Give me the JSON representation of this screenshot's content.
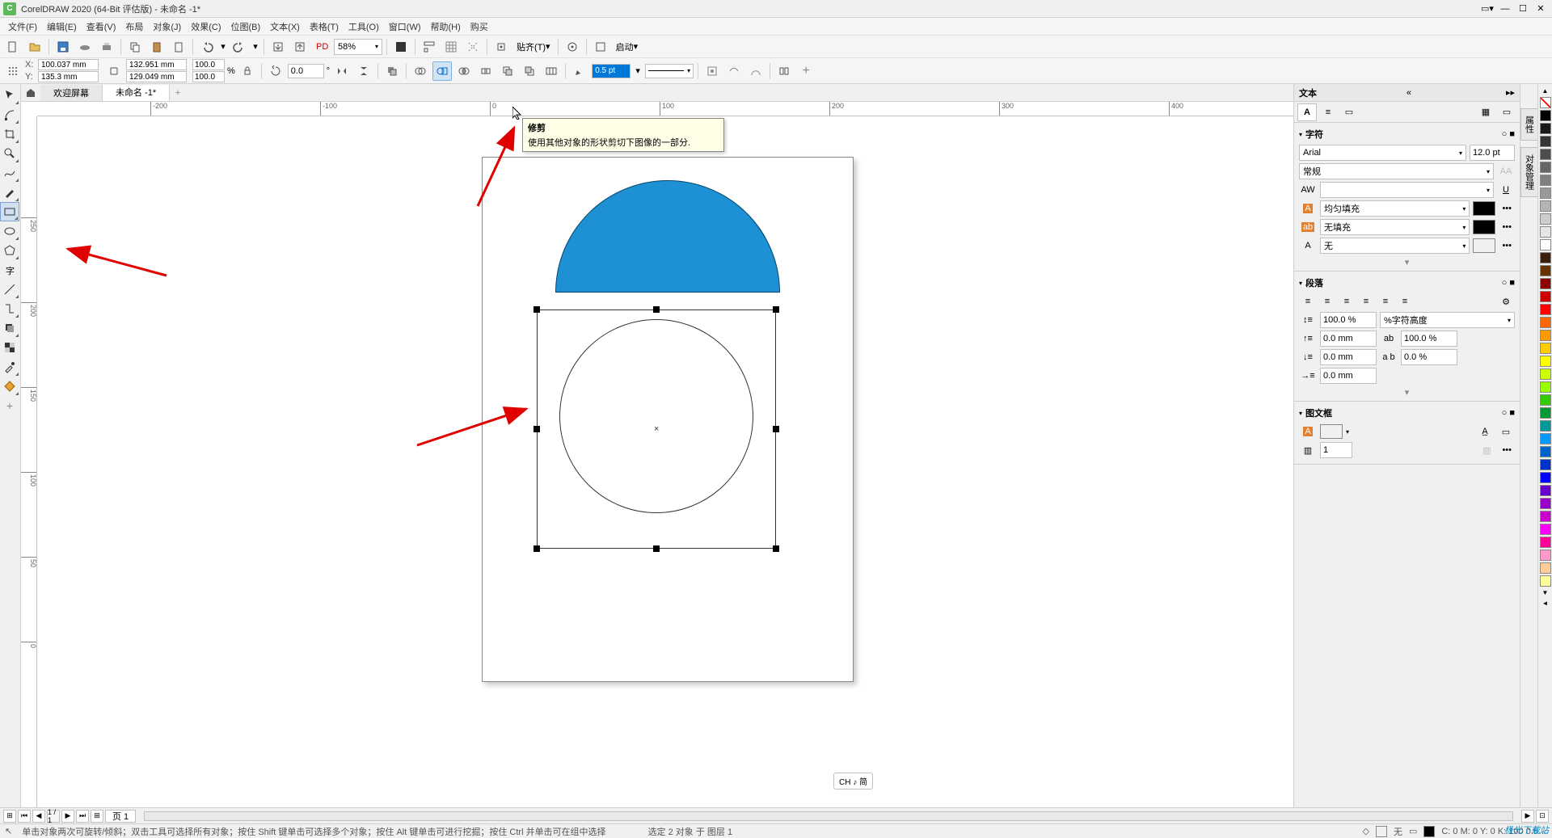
{
  "titlebar": {
    "app": "CorelDRAW 2020 (64-Bit 评估版) - 未命名 -1*"
  },
  "menu": [
    "文件(F)",
    "编辑(E)",
    "查看(V)",
    "布局",
    "对象(J)",
    "效果(C)",
    "位图(B)",
    "文本(X)",
    "表格(T)",
    "工具(O)",
    "窗口(W)",
    "帮助(H)",
    "购买"
  ],
  "toolbar1": {
    "zoom": "58%",
    "snap": "贴齐(T)",
    "launch": "启动"
  },
  "propbar": {
    "x": "100.037 mm",
    "y": "135.3 mm",
    "w": "132.951 mm",
    "h": "129.049 mm",
    "sx": "100.0",
    "sy": "100.0",
    "pct": "%",
    "rot": "0.0",
    "deg": "°",
    "outline": "0.5 pt"
  },
  "tooltip": {
    "title": "修剪",
    "body": "使用其他对象的形状剪切下图像的一部分."
  },
  "tabs": {
    "welcome": "欢迎屏幕",
    "doc": "未命名 -1*"
  },
  "hruler": [
    "-200",
    "-100",
    "0",
    "100",
    "200",
    "300",
    "400"
  ],
  "vruler": [
    "0",
    "50",
    "100",
    "150",
    "200",
    "250"
  ],
  "pagebar": {
    "page": "页 1"
  },
  "status": {
    "hint": "单击对象两次可旋转/倾斜；双击工具可选择所有对象；按住 Shift 键单击可选择多个对象；按住 Alt 键单击可进行挖掘；按住 Ctrl 并单击可在组中选择",
    "sel": "选定 2 对象 于 图层 1",
    "fill_none": "无",
    "cmyk": "C: 0 M: 0 Y: 0 K: 100 0.5…",
    "ch": "CH ♪ 简"
  },
  "dock": {
    "title": "文本",
    "char": "字符",
    "font": "Arial",
    "size": "12.0 pt",
    "style": "常规",
    "fill_uniform": "均匀填充",
    "fill_none": "无填充",
    "none": "无",
    "para": "段落",
    "line100": "100.0 %",
    "line_type": "%字符高度",
    "indent0": "0.0 mm",
    "pct100": "100.0 %",
    "pct0": "0.0 %",
    "frame": "图文框",
    "cols": "1"
  },
  "sidetabs": [
    "属性",
    "对象管理"
  ],
  "colors": [
    "#000000",
    "#ffffff",
    "#b30000",
    "#ff0000",
    "#ff8000",
    "#ffff00",
    "#80ff00",
    "#00ff00",
    "#00ff80",
    "#00ffff",
    "#0080ff",
    "#0000ff",
    "#8000ff",
    "#ff00ff",
    "#ff0080",
    "#804000",
    "#808080",
    "#c0c0c0"
  ],
  "watermark": "极光下载站"
}
